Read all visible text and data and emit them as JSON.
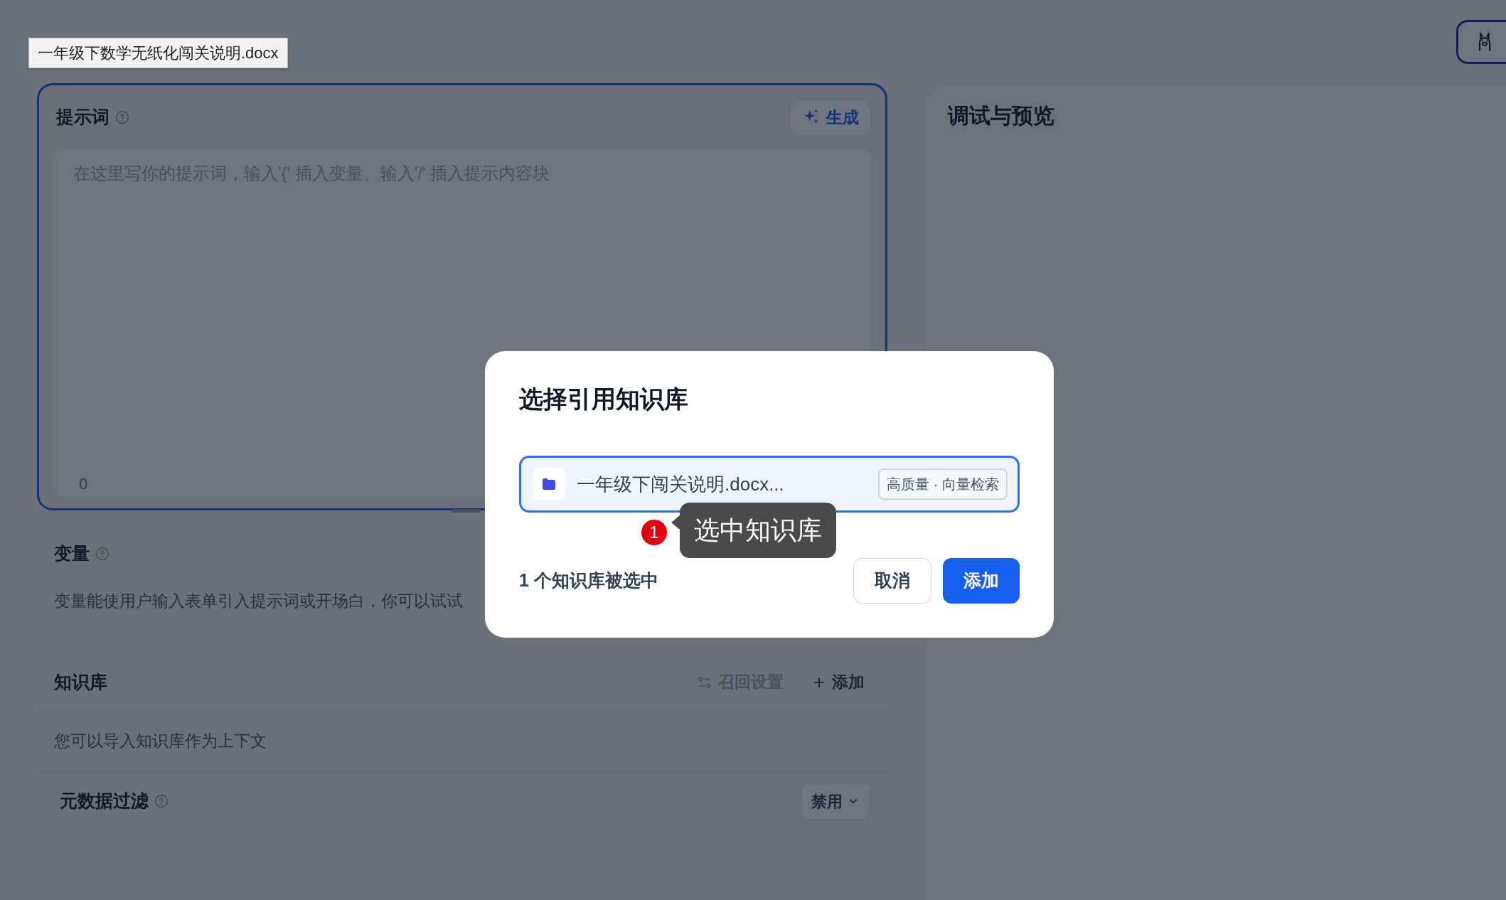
{
  "tooltip": {
    "text": "一年级下数学无纸化闯关说明.docx"
  },
  "prompt": {
    "title": "提示词",
    "generate_button": "生成",
    "placeholder": "在这里写你的提示词，输入'{' 插入变量、输入'/' 插入提示内容块",
    "char_count": "0",
    "focused": true
  },
  "variables": {
    "title": "变量",
    "description": "变量能使用户输入表单引入提示词或开场白，你可以试试"
  },
  "knowledge": {
    "title": "知识库",
    "recall_settings": {
      "label": "召回设置",
      "disabled": true
    },
    "add_button": "添加",
    "description": "您可以导入知识库作为上下文",
    "metadata_filter": {
      "label": "元数据过滤",
      "value": "禁用"
    }
  },
  "preview": {
    "title": "调试与预览"
  },
  "modal": {
    "title": "选择引用知识库",
    "items": [
      {
        "name": "一年级下闯关说明.docx...",
        "tag": "高质量 · 向量检索",
        "selected": true
      }
    ],
    "annotation": {
      "number": "1",
      "text": "选中知识库"
    },
    "selection_count": "1 个知识库被选中",
    "cancel_button": "取消",
    "confirm_button": "添加"
  }
}
